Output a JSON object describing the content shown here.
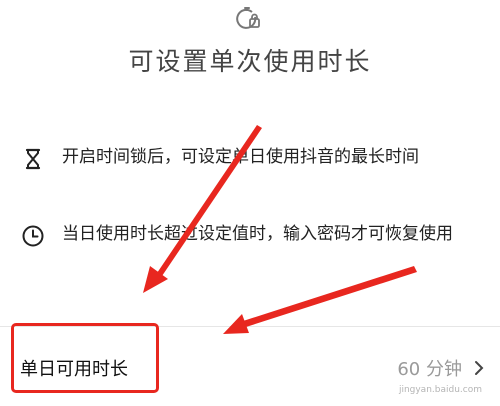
{
  "page": {
    "title": "可设置单次使用时长",
    "top_icon": "timer-lock-icon"
  },
  "features": [
    {
      "icon": "hourglass-icon",
      "text": "开启时间锁后，可设定单日使用抖音的最长时间"
    },
    {
      "icon": "clock-icon",
      "text": "当日使用时长超过设定值时，输入密码才可恢复使用"
    }
  ],
  "setting": {
    "label": "单日可用时长",
    "value": "60 分钟",
    "chevron": "chevron-right-icon"
  },
  "annotations": {
    "arrow_color": "#e8271f",
    "box_color": "#e8271f"
  },
  "watermark": "jingyan.baidu.com"
}
